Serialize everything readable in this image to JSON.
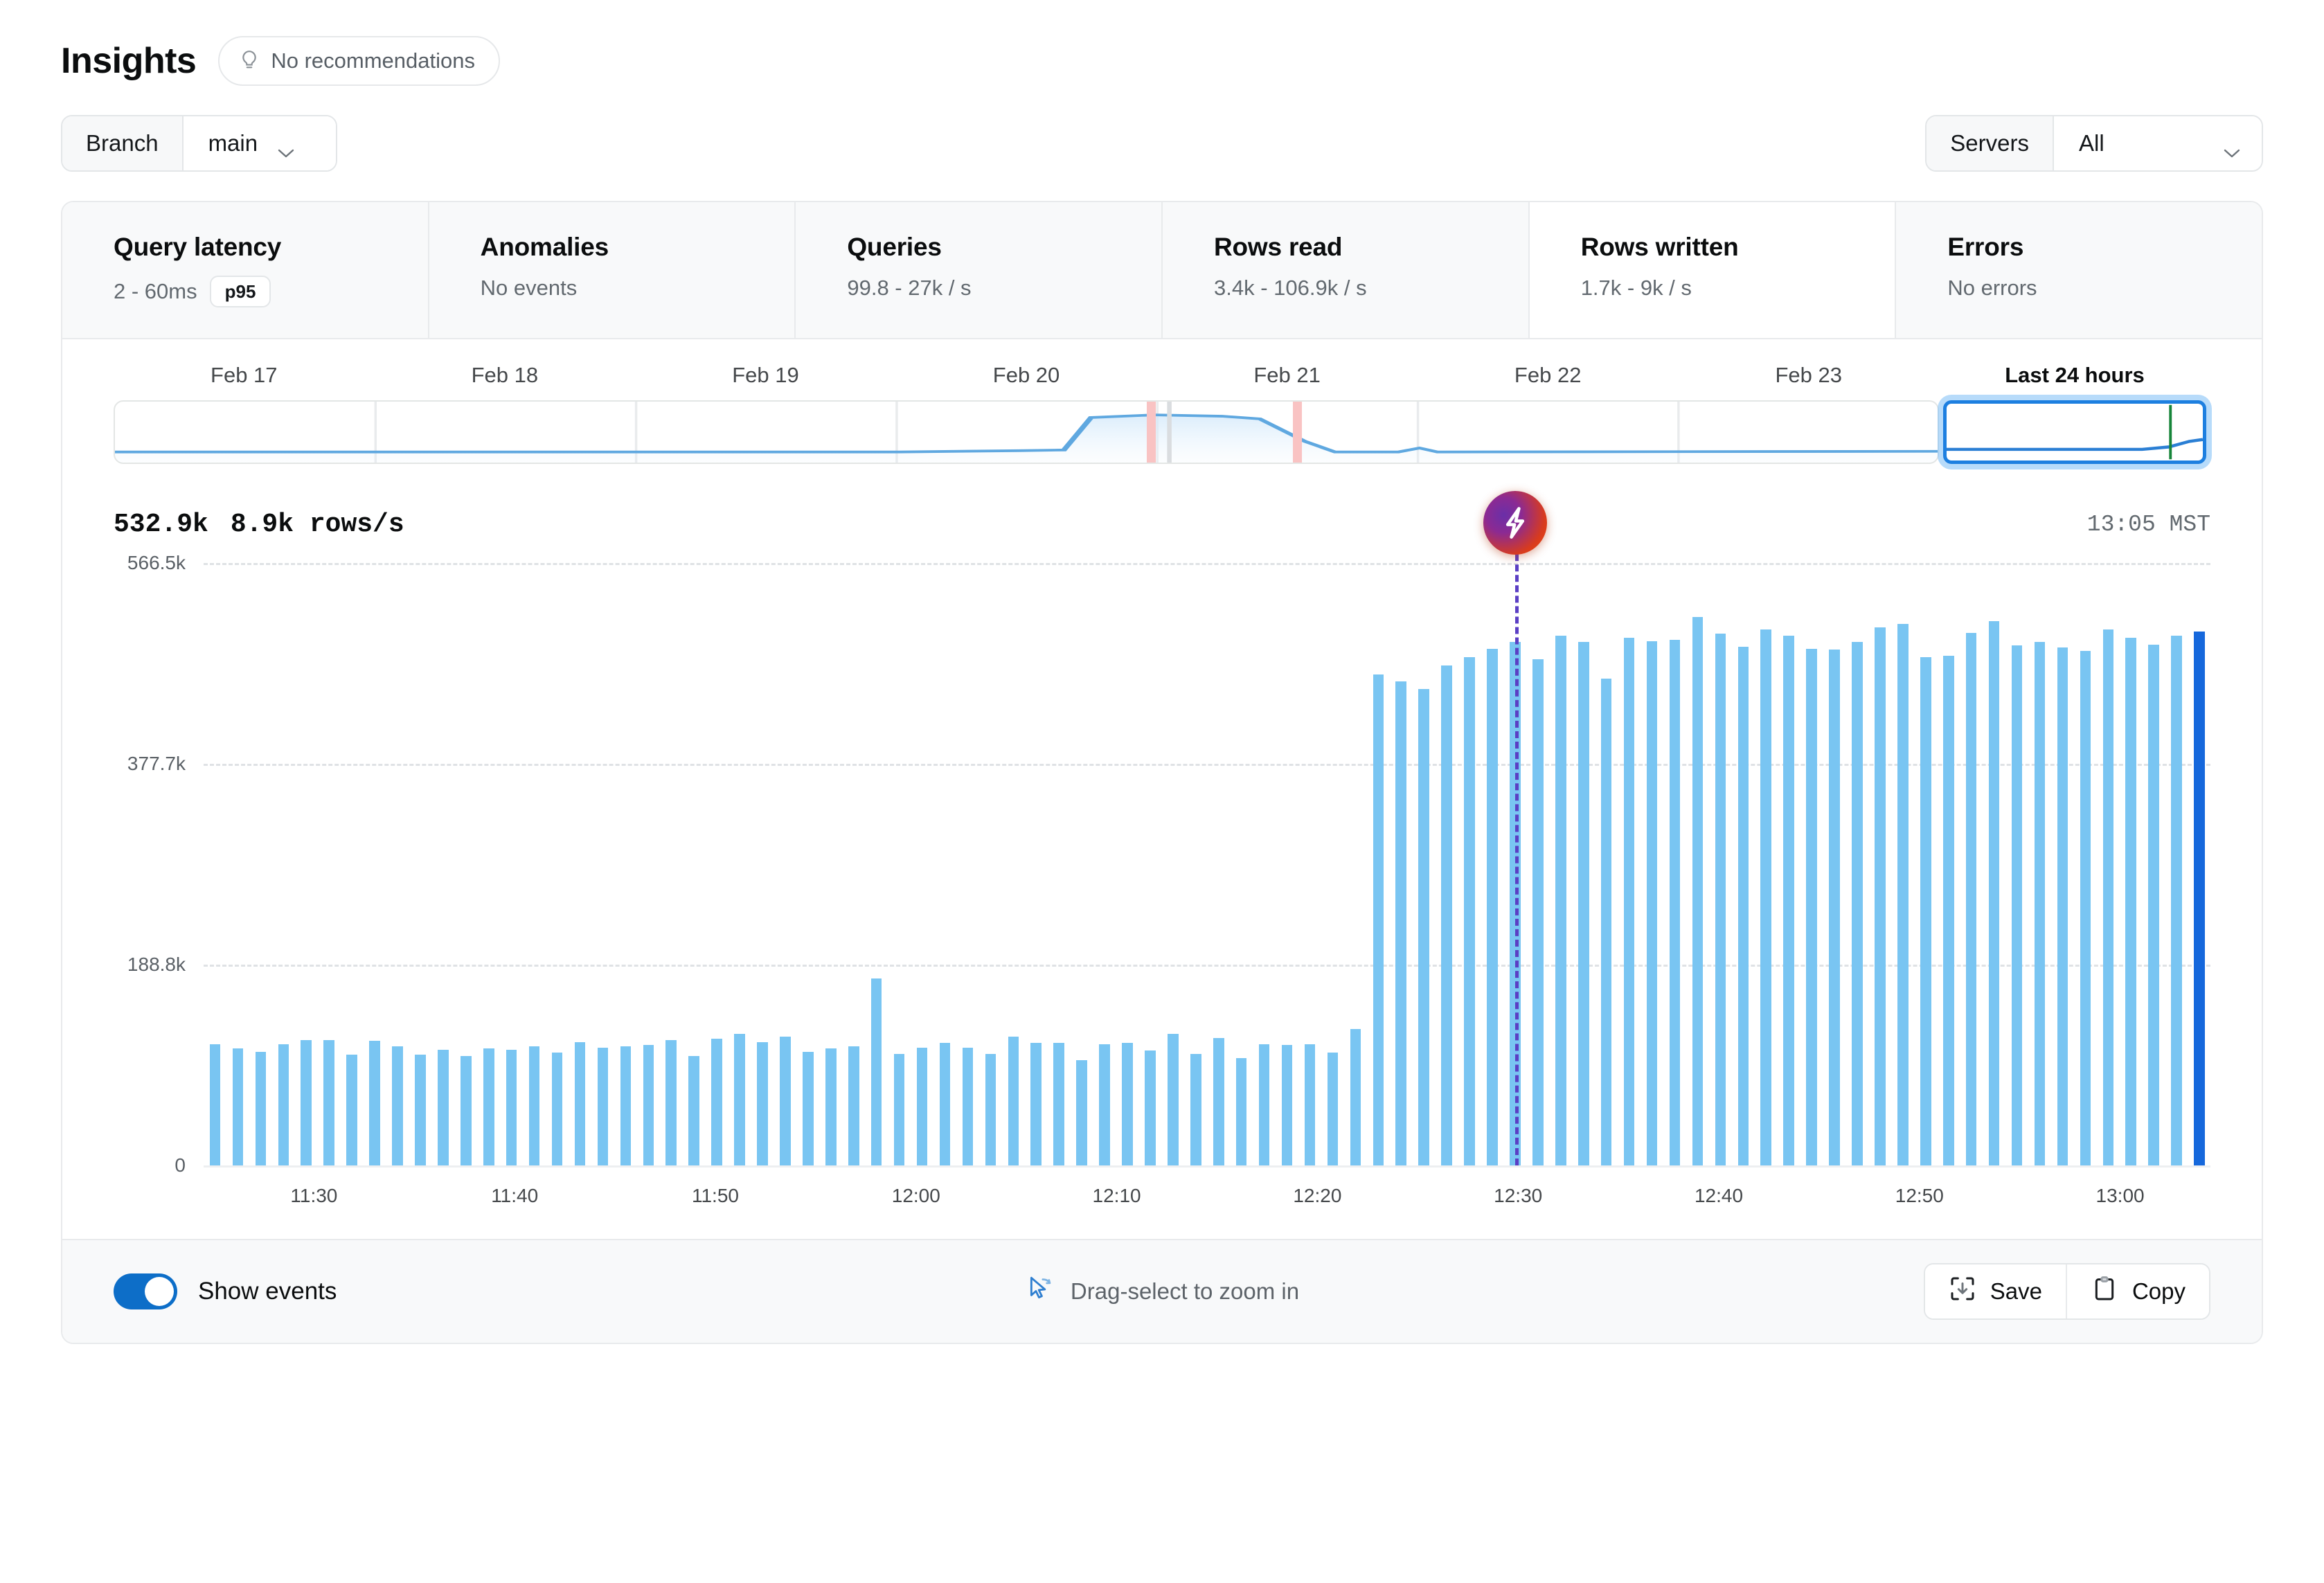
{
  "header": {
    "title": "Insights",
    "recommendations_label": "No recommendations",
    "bulb_icon": "lightbulb-icon"
  },
  "filters": {
    "branch": {
      "label": "Branch",
      "value": "main",
      "chevron": "chevron-down-icon"
    },
    "servers": {
      "label": "Servers",
      "value": "All",
      "chevron": "chevron-down-icon"
    }
  },
  "stats": [
    {
      "title": "Query latency",
      "value": "2 - 60ms",
      "badge": "p95",
      "selected": false
    },
    {
      "title": "Anomalies",
      "value": "No events",
      "badge": "",
      "selected": false
    },
    {
      "title": "Queries",
      "value": "99.8 - 27k / s",
      "badge": "",
      "selected": false
    },
    {
      "title": "Rows read",
      "value": "3.4k - 106.9k / s",
      "badge": "",
      "selected": false
    },
    {
      "title": "Rows written",
      "value": "1.7k - 9k / s",
      "badge": "",
      "selected": true
    },
    {
      "title": "Errors",
      "value": "No errors",
      "badge": "",
      "selected": false
    }
  ],
  "range_strip": {
    "day_labels": [
      "Feb 17",
      "Feb 18",
      "Feb 19",
      "Feb 20",
      "Feb 21",
      "Feb 22",
      "Feb 23"
    ],
    "selection_label": "Last 24 hours"
  },
  "chart_header": {
    "peak_value": "532.9k",
    "rate_value": "8.9k rows/s",
    "timestamp": "13:05 MST"
  },
  "footer": {
    "show_events_label": "Show events",
    "show_events_on": true,
    "hint_label": "Drag-select to zoom in",
    "hint_icon": "cursor-arrow-icon",
    "save_label": "Save",
    "save_icon": "save-frame-icon",
    "copy_label": "Copy",
    "copy_icon": "clipboard-icon"
  },
  "colors": {
    "bar": "#79c5f2",
    "bar_last": "#1668dc",
    "accent": "#0d6ec8",
    "event_line": "#5b3fc4",
    "selection_border": "#1d7fe0",
    "now_marker": "#17853a"
  },
  "chart_data": {
    "type": "bar",
    "title": "Rows written",
    "xlabel": "",
    "ylabel": "",
    "ylim": [
      0,
      566500
    ],
    "grid": true,
    "ytick_labels": [
      "566.5k",
      "377.7k",
      "188.8k",
      "0"
    ],
    "ytick_values": [
      566500,
      377700,
      188800,
      0
    ],
    "xtick_labels": [
      "11:30",
      "11:40",
      "11:50",
      "12:00",
      "12:10",
      "12:20",
      "12:30",
      "12:40",
      "12:50",
      "13:00"
    ],
    "event_marker": {
      "icon": "lightning-bolt-icon",
      "x_index": 57,
      "label": ""
    },
    "last_bar_highlighted": true,
    "values": [
      114000,
      110000,
      107000,
      114000,
      118000,
      118000,
      104000,
      117000,
      112000,
      104000,
      109000,
      103000,
      110000,
      109000,
      112000,
      106000,
      116000,
      111000,
      112000,
      113000,
      118000,
      103000,
      119000,
      124000,
      116000,
      121000,
      107000,
      110000,
      112000,
      176000,
      105000,
      111000,
      115000,
      111000,
      105000,
      121000,
      115000,
      115000,
      99000,
      114000,
      115000,
      108000,
      124000,
      105000,
      120000,
      101000,
      114000,
      113000,
      114000,
      106000,
      128000,
      462000,
      455000,
      448000,
      470000,
      478000,
      486000,
      492000,
      476000,
      498000,
      492000,
      458000,
      496000,
      493000,
      494000,
      516000,
      500000,
      488000,
      504000,
      498000,
      486000,
      485000,
      492000,
      506000,
      509000,
      478000,
      479000,
      501000,
      512000,
      489000,
      492000,
      487000,
      484000,
      504000,
      496000,
      490000,
      498000,
      502000
    ]
  }
}
